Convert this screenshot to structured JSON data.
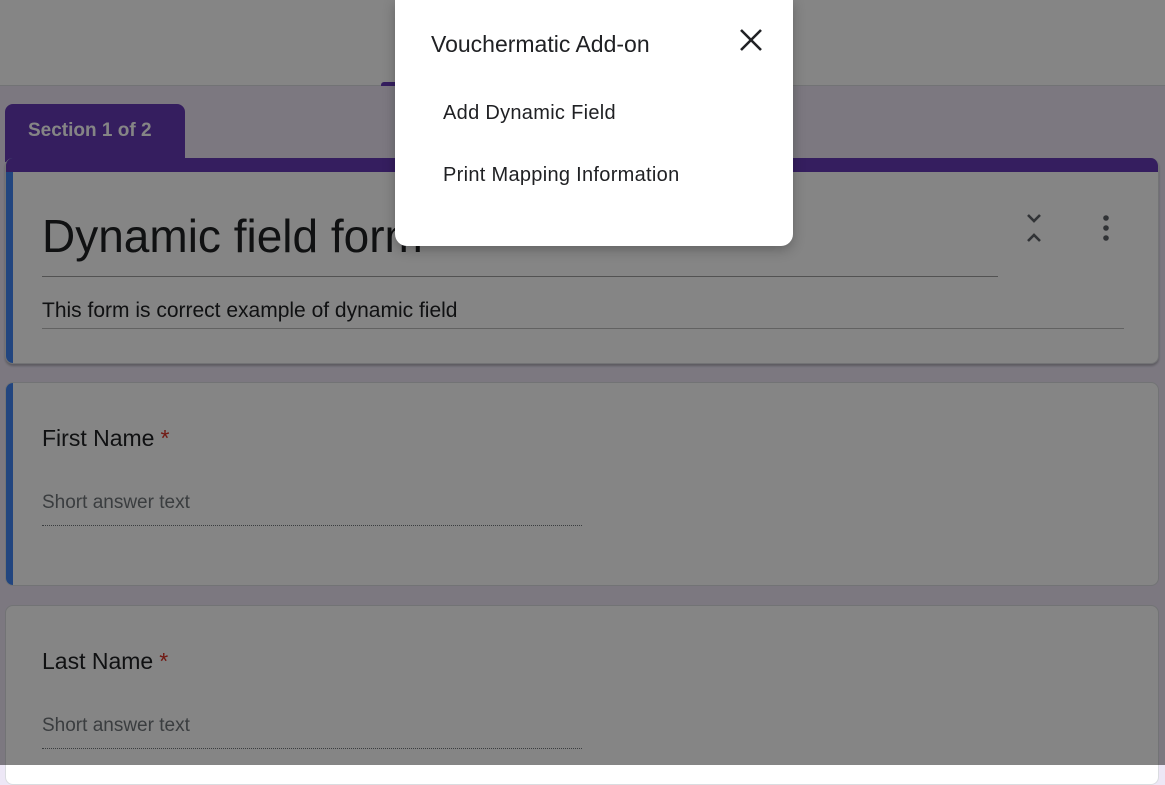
{
  "section_tab": {
    "label": "Section 1 of 2"
  },
  "form": {
    "title": "Dynamic field form",
    "description": "This form is correct example of dynamic field"
  },
  "questions": [
    {
      "title": "First Name",
      "required_mark": "*",
      "placeholder": "Short answer text"
    },
    {
      "title": "Last Name",
      "required_mark": "*",
      "placeholder": "Short answer text"
    }
  ],
  "dialog": {
    "title": "Vouchermatic Add-on",
    "close_icon": "close-icon",
    "items": [
      {
        "label": "Add Dynamic Field"
      },
      {
        "label": "Print Mapping Information"
      }
    ]
  },
  "icons": {
    "collapse": "collapse-icon",
    "more": "more-vert-icon"
  },
  "colors": {
    "theme_purple": "#673ab7",
    "active_blue": "#4285f4",
    "required_red": "#d93025",
    "page_bg": "#ede7f6"
  }
}
